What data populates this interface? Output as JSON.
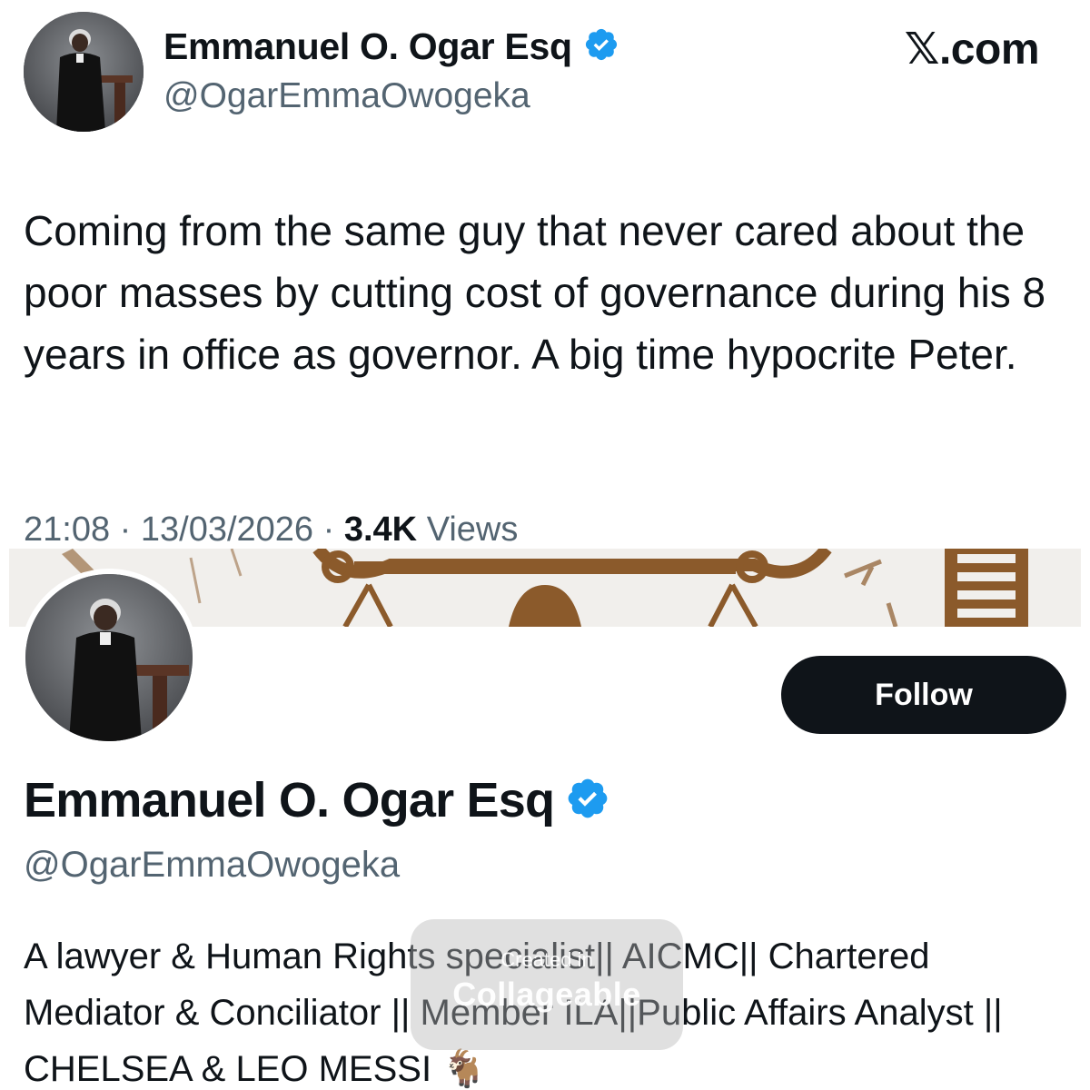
{
  "tweet": {
    "author_name": "Emmanuel O. Ogar Esq",
    "author_handle": "@OgarEmmaOwogeka",
    "brand": "𝕏.com",
    "text": "Coming from the same guy that never cared about the poor masses by cutting cost of governance during his 8 years in office as governor. A big time hypocrite Peter.",
    "time": "21:08",
    "date": "13/03/2026",
    "views_count": "3.4K",
    "views_label": "Views",
    "separator": "·"
  },
  "profile": {
    "follow_label": "Follow",
    "name": "Emmanuel O. Ogar Esq",
    "handle": "@OgarEmmaOwogeka",
    "bio": "A lawyer & Human Rights specialist|| AICMC|| Chartered Mediator & Conciliator || Member ILA||Public Affairs Analyst || CHELSEA & LEO MESSI 🐐"
  },
  "watermark": {
    "line1": "Created in",
    "line2": "Collageable"
  },
  "colors": {
    "text_primary": "#0f1419",
    "text_secondary": "#536471",
    "verified_blue": "#1d9bf0",
    "follow_bg": "#0f1419",
    "banner_brown": "#8b5a2b"
  },
  "icons": {
    "verified": "verified-badge-icon",
    "avatar": "profile-photo"
  }
}
